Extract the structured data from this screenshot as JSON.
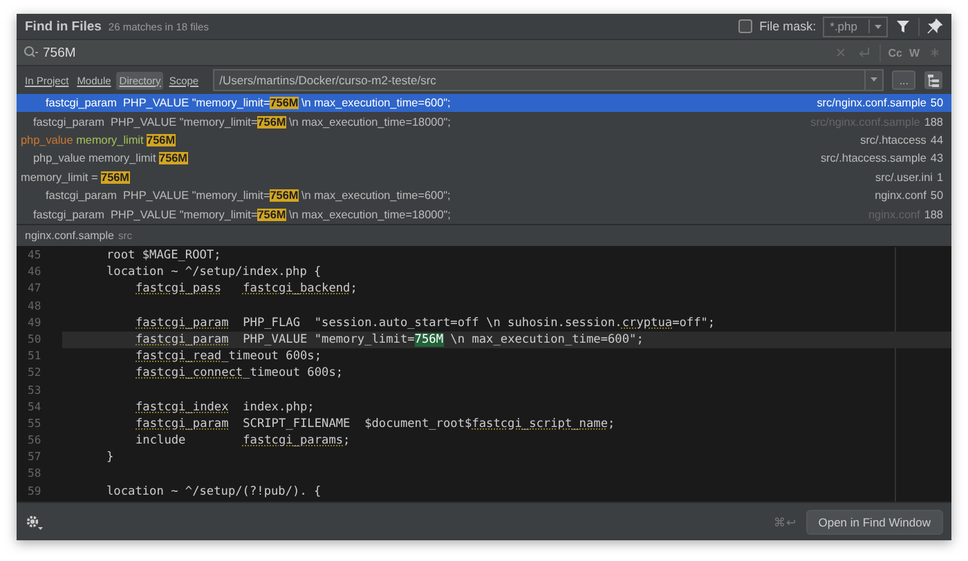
{
  "dialog": {
    "title": "Find in Files",
    "summary": "26 matches in 18 files"
  },
  "file_mask": {
    "label": "File mask:",
    "checked": false,
    "value": "*.php"
  },
  "search": {
    "value": "756M",
    "options": [
      "Cc",
      "W"
    ]
  },
  "scope_tabs": [
    {
      "label": "In Project",
      "selected": false
    },
    {
      "label": "Module",
      "selected": false
    },
    {
      "label": "Directory",
      "selected": true
    },
    {
      "label": "Scope",
      "selected": false
    }
  ],
  "directory": {
    "value": "/Users/martins/Docker/curso-m2-teste/src",
    "browse": "..."
  },
  "results": [
    {
      "selected": true,
      "kind": "deep",
      "file_dimmed": false,
      "file": "src/nginx.conf.sample",
      "line": "50",
      "segments": [
        {
          "kind": "text",
          "text": "fastcgi_param  PHP_VALUE \"memory_limit="
        },
        {
          "kind": "match",
          "text": "756M"
        },
        {
          "kind": "text",
          "text": " \\n max_execution_time=600\";"
        }
      ]
    },
    {
      "selected": false,
      "kind": "indented",
      "file_dimmed": true,
      "file": "src/nginx.conf.sample",
      "line": "188",
      "segments": [
        {
          "kind": "text",
          "text": "fastcgi_param  PHP_VALUE \"memory_limit="
        },
        {
          "kind": "match",
          "text": "756M"
        },
        {
          "kind": "text",
          "text": " \\n max_execution_time=18000\";"
        }
      ]
    },
    {
      "selected": false,
      "kind": "flat",
      "file_dimmed": false,
      "file": "src/.htaccess",
      "line": "44",
      "segments": [
        {
          "kind": "directive",
          "text": "php_value"
        },
        {
          "kind": "option",
          "text": " memory_limit "
        },
        {
          "kind": "match",
          "text": "756M"
        }
      ]
    },
    {
      "selected": false,
      "kind": "indented",
      "file_dimmed": false,
      "file": "src/.htaccess.sample",
      "line": "43",
      "segments": [
        {
          "kind": "text",
          "text": "php_value memory_limit "
        },
        {
          "kind": "match",
          "text": "756M"
        }
      ]
    },
    {
      "selected": false,
      "kind": "flat",
      "file_dimmed": false,
      "file": "src/.user.ini",
      "line": "1",
      "segments": [
        {
          "kind": "text",
          "text": "memory_limit = "
        },
        {
          "kind": "match",
          "text": "756M"
        }
      ]
    },
    {
      "selected": false,
      "kind": "deep",
      "file_dimmed": false,
      "file": "nginx.conf",
      "line": "50",
      "segments": [
        {
          "kind": "text",
          "text": "fastcgi_param  PHP_VALUE \"memory_limit="
        },
        {
          "kind": "match",
          "text": "756M"
        },
        {
          "kind": "text",
          "text": " \\n max_execution_time=600\";"
        }
      ]
    },
    {
      "selected": false,
      "kind": "indented",
      "file_dimmed": true,
      "file": "nginx.conf",
      "line": "188",
      "segments": [
        {
          "kind": "text",
          "text": "fastcgi_param  PHP_VALUE \"memory_limit="
        },
        {
          "kind": "match",
          "text": "756M"
        },
        {
          "kind": "text",
          "text": " \\n max_execution_time=18000\";"
        }
      ]
    }
  ],
  "preview": {
    "file": "nginx.conf.sample",
    "folder": "src",
    "lines": [
      {
        "number": "45",
        "current": false,
        "segments": [
          {
            "kind": "text",
            "text": "root $MAGE_ROOT;"
          }
        ]
      },
      {
        "number": "46",
        "current": false,
        "segments": [
          {
            "kind": "text",
            "text": "location ~ ^/setup/index.php {"
          }
        ],
        "children": [
          {
            "number": "47",
            "current": false,
            "segments": [
              {
                "kind": "flag",
                "text": "fastcgi_pass"
              },
              {
                "kind": "gap"
              },
              {
                "kind": "flag",
                "text": "fastcgi_backend"
              },
              {
                "kind": "text",
                "text": ";"
              }
            ]
          },
          {
            "number": "48",
            "current": false
          },
          {
            "number": "49",
            "current": false,
            "segments": [
              {
                "kind": "flag",
                "text": "fastcgi_param"
              },
              {
                "kind": "text",
                "text": "  PHP_FLAG  \"session.auto_start=off \\n suhosin.session."
              },
              {
                "kind": "flag",
                "text": "cryptua"
              },
              {
                "kind": "text",
                "text": "=off\";"
              }
            ]
          },
          {
            "number": "50",
            "current": true,
            "segments": [
              {
                "kind": "flag",
                "text": "fastcgi_param"
              },
              {
                "kind": "text",
                "text": "  PHP_VALUE \"memory_limit="
              },
              {
                "kind": "match",
                "text": "756M"
              },
              {
                "kind": "text",
                "text": " \\n max_execution_time=600\";"
              }
            ]
          },
          {
            "number": "51",
            "current": false,
            "segments": [
              {
                "kind": "flag",
                "text": "fastcgi_read"
              },
              {
                "kind": "text",
                "text": "_timeout 600s;"
              }
            ]
          },
          {
            "number": "52",
            "current": false,
            "segments": [
              {
                "kind": "flag",
                "text": "fastcgi_connect"
              },
              {
                "kind": "text",
                "text": "_timeout 600s;"
              }
            ]
          },
          {
            "number": "53",
            "current": false
          },
          {
            "number": "54",
            "current": false,
            "segments": [
              {
                "kind": "flag",
                "text": "fastcgi_index"
              },
              {
                "kind": "text",
                "text": "  index.php;"
              }
            ]
          },
          {
            "number": "55",
            "current": false,
            "segments": [
              {
                "kind": "flag",
                "text": "fastcgi_param"
              },
              {
                "kind": "text",
                "text": "  SCRIPT_FILENAME  $document_root$"
              },
              {
                "kind": "flag",
                "text": "fastcgi_script_name"
              },
              {
                "kind": "text",
                "text": ";"
              }
            ]
          },
          {
            "number": "56",
            "current": false,
            "segments": [
              {
                "kind": "text",
                "text": "include        "
              },
              {
                "kind": "flag",
                "text": "fastcgi_params"
              },
              {
                "kind": "text",
                "text": ";"
              }
            ]
          }
        ]
      },
      {
        "number": "57",
        "current": false,
        "segments": [
          {
            "kind": "text",
            "text": "}"
          }
        ]
      },
      {
        "number": "58",
        "current": false
      },
      {
        "number": "59",
        "current": false,
        "segments": [
          {
            "kind": "text",
            "text": "location ~ ^/setup/(?!pub/). {"
          }
        ]
      }
    ]
  },
  "footer": {
    "shortcut": "⌘↩",
    "button": "Open in Find Window"
  }
}
